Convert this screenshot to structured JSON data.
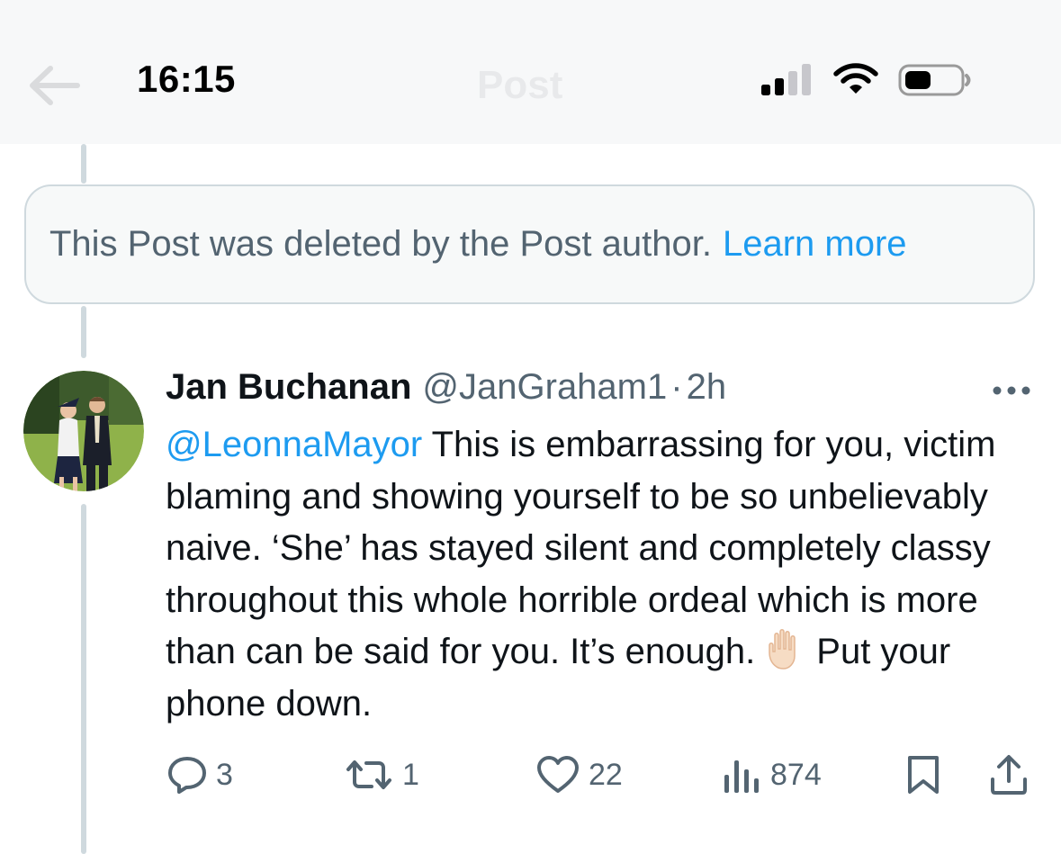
{
  "status_bar": {
    "time": "16:15"
  },
  "nav": {
    "title": "Post"
  },
  "deleted_notice": {
    "text": "This Post was deleted by the Post author.",
    "link": "Learn more"
  },
  "tweet": {
    "display_name": "Jan Buchanan",
    "handle": "@JanGraham1",
    "separator": "·",
    "age": "2h",
    "mention": "@LeonnaMayor",
    "text_part1": "This is embarrassing for you, victim blaming and showing yourself to be so unbelievably naive. ‘She’ has stayed silent and completely classy throughout this whole horrible ordeal which is more than can be said for you. It’s enough.",
    "emoji": "raised-hand",
    "text_part2": "Put your phone down.",
    "actions": {
      "replies": "3",
      "reposts": "1",
      "likes": "22",
      "views": "874"
    }
  },
  "colors": {
    "link": "#1d9bf0",
    "secondary_text": "#536471",
    "primary_text": "#0f1419",
    "border": "#cfd9de"
  },
  "icons": [
    "back-arrow-icon",
    "signal-icon",
    "wifi-icon",
    "battery-icon",
    "more-icon",
    "reply-icon",
    "repost-icon",
    "like-icon",
    "views-icon",
    "bookmark-icon",
    "share-icon",
    "raised-hand-emoji"
  ]
}
